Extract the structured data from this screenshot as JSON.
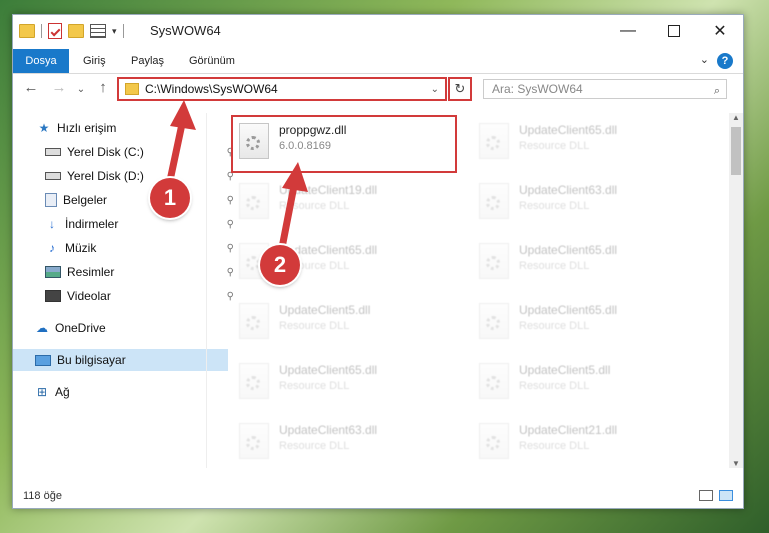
{
  "window": {
    "title": "SysWOW64"
  },
  "ribbon": {
    "tabs": [
      "Dosya",
      "Giriş",
      "Paylaş",
      "Görünüm"
    ]
  },
  "nav": {
    "address": "C:\\Windows\\SysWOW64",
    "search_placeholder": "Ara: SysWOW64"
  },
  "sidebar": {
    "items": [
      {
        "label": "Hızlı erişim",
        "icon": "star-icon"
      },
      {
        "label": "Yerel Disk (C:)",
        "icon": "disk-icon"
      },
      {
        "label": "Yerel Disk (D:)",
        "icon": "disk-icon"
      },
      {
        "label": "Belgeler",
        "icon": "documents-icon"
      },
      {
        "label": "İndirmeler",
        "icon": "download-icon"
      },
      {
        "label": "Müzik",
        "icon": "music-icon"
      },
      {
        "label": "Resimler",
        "icon": "pictures-icon"
      },
      {
        "label": "Videolar",
        "icon": "videos-icon"
      },
      {
        "label": "OneDrive",
        "icon": "cloud-icon"
      },
      {
        "label": "Bu bilgisayar",
        "icon": "computer-icon"
      },
      {
        "label": "Ağ",
        "icon": "network-icon"
      }
    ]
  },
  "files": [
    {
      "name": "proppgwz.dll",
      "desc": "6.0.0.8169"
    },
    {
      "name": "UpdateClient65.dll",
      "desc": "Resource DLL"
    },
    {
      "name": "UpdateClient19.dll",
      "desc": "Resource DLL"
    },
    {
      "name": "UpdateClient63.dll",
      "desc": "Resource DLL"
    },
    {
      "name": "UpdateClient65.dll",
      "desc": "Resource DLL"
    },
    {
      "name": "UpdateClient65.dll",
      "desc": "Resource DLL"
    },
    {
      "name": "UpdateClient5.dll",
      "desc": "Resource DLL"
    },
    {
      "name": "UpdateClient65.dll",
      "desc": "Resource DLL"
    },
    {
      "name": "UpdateClient65.dll",
      "desc": "Resource DLL"
    },
    {
      "name": "UpdateClient5.dll",
      "desc": "Resource DLL"
    },
    {
      "name": "UpdateClient63.dll",
      "desc": "Resource DLL"
    },
    {
      "name": "UpdateClient21.dll",
      "desc": "Resource DLL"
    }
  ],
  "status": {
    "count": "118 öğe"
  },
  "annotations": {
    "step1": "1",
    "step2": "2"
  },
  "colors": {
    "accent": "#1979ca",
    "highlight": "#d23a3a"
  }
}
